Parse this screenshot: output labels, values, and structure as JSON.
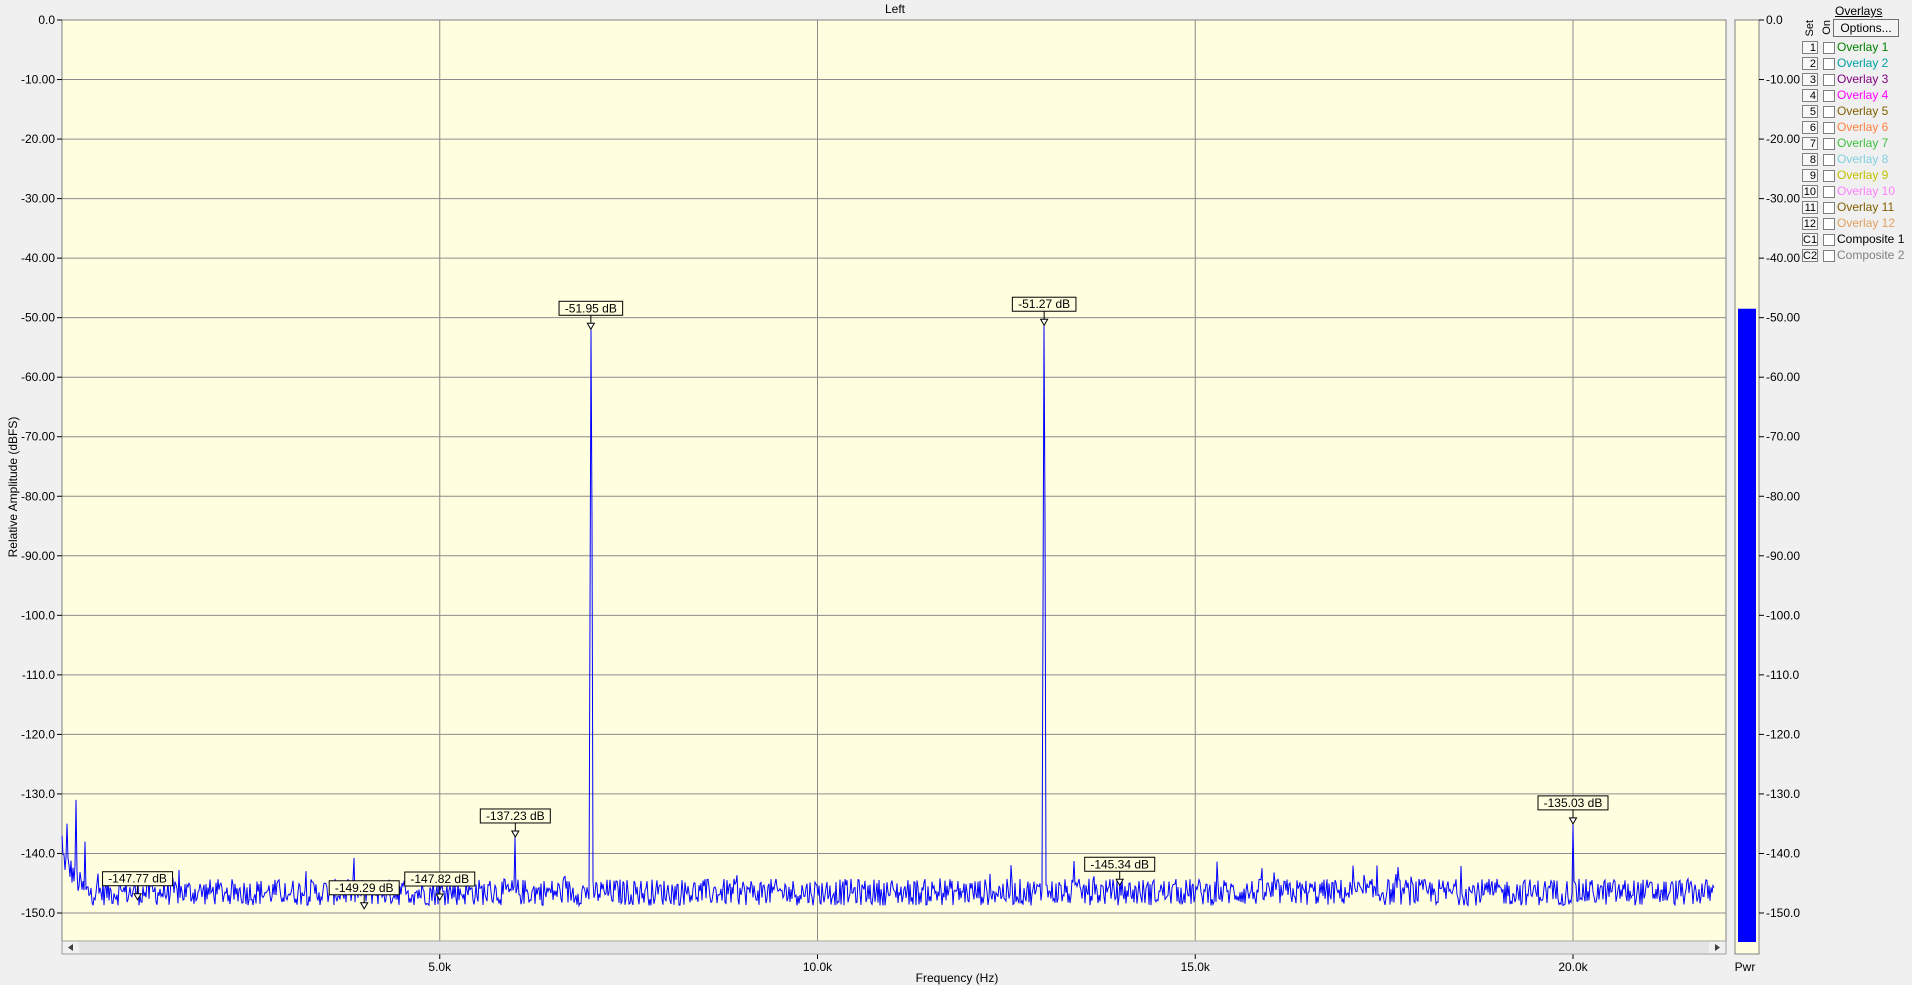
{
  "chart_data": {
    "type": "line",
    "title": "Left",
    "xlabel": "Frequency (Hz)",
    "ylabel": "Relative Amplitude (dBFS)",
    "xlim": [
      0,
      22050
    ],
    "ylim": [
      -157,
      0
    ],
    "x_tick_labels": [
      "5.0k",
      "10.0k",
      "15.0k",
      "20.0k"
    ],
    "x_ticks": [
      5000,
      10000,
      15000,
      20000
    ],
    "y_ticks": [
      0,
      -10,
      -20,
      -30,
      -40,
      -50,
      -60,
      -70,
      -80,
      -90,
      -100,
      -110,
      -120,
      -130,
      -140,
      -150
    ],
    "y_tick_labels": [
      "0.0",
      "-10.00",
      "-20.00",
      "-30.00",
      "-40.00",
      "-50.00",
      "-60.00",
      "-70.00",
      "-80.00",
      "-90.00",
      "-100.0",
      "-110.0",
      "-120.0",
      "-130.0",
      "-140.0",
      "-150.0"
    ],
    "grid": true,
    "noise_floor_db": -146.5,
    "series": [
      {
        "color": "#0000ff",
        "peaks": [
          {
            "x": 0,
            "y": -137
          },
          {
            "x": 60,
            "y": -135
          },
          {
            "x": 180,
            "y": -131
          },
          {
            "x": 300,
            "y": -138
          },
          {
            "x": 6000,
            "y": -137.23
          },
          {
            "x": 7000,
            "y": -51.95
          },
          {
            "x": 13000,
            "y": -51.27
          },
          {
            "x": 17400,
            "y": -142
          },
          {
            "x": 20000,
            "y": -135.03
          }
        ]
      }
    ],
    "markers": [
      {
        "x": 7000,
        "y": -51.95,
        "label": "-51.95 dB"
      },
      {
        "x": 13000,
        "y": -51.27,
        "label": "-51.27 dB"
      },
      {
        "x": 6000,
        "y": -137.23,
        "label": "-137.23 dB"
      },
      {
        "x": 20000,
        "y": -135.03,
        "label": "-135.03 dB"
      },
      {
        "x": 1000,
        "y": -147.77,
        "label": "-147.77 dB"
      },
      {
        "x": 4000,
        "y": -149.29,
        "label": "-149.29 dB"
      },
      {
        "x": 5000,
        "y": -147.82,
        "label": "-147.82 dB"
      },
      {
        "x": 14000,
        "y": -145.34,
        "label": "-145.34 dB"
      }
    ],
    "level_meter": {
      "value_db": -48.5,
      "label": "Pwr",
      "tick_labels": [
        "0.0",
        "-10.00",
        "-20.00",
        "-30.00",
        "-40.00",
        "-50.00",
        "-60.00",
        "-70.00",
        "-80.00",
        "-90.00",
        "-100.0",
        "-110.0",
        "-120.0",
        "-130.0",
        "-140.0",
        "-150.0"
      ],
      "color": "#0000ff"
    }
  },
  "overlays": {
    "title": "Overlays",
    "options_label": "Options...",
    "set_header": "Set",
    "on_header": "On",
    "items": [
      {
        "num": "1",
        "label": "Overlay 1",
        "color": "#008000"
      },
      {
        "num": "2",
        "label": "Overlay 2",
        "color": "#00a0a0"
      },
      {
        "num": "3",
        "label": "Overlay 3",
        "color": "#800080"
      },
      {
        "num": "4",
        "label": "Overlay 4",
        "color": "#ff00ff"
      },
      {
        "num": "5",
        "label": "Overlay 5",
        "color": "#806000"
      },
      {
        "num": "6",
        "label": "Overlay 6",
        "color": "#ff8040"
      },
      {
        "num": "7",
        "label": "Overlay 7",
        "color": "#40c040"
      },
      {
        "num": "8",
        "label": "Overlay 8",
        "color": "#80d0e0"
      },
      {
        "num": "9",
        "label": "Overlay 9",
        "color": "#c0c000"
      },
      {
        "num": "10",
        "label": "Overlay 10",
        "color": "#ff80ff"
      },
      {
        "num": "11",
        "label": "Overlay 11",
        "color": "#806000"
      },
      {
        "num": "12",
        "label": "Overlay 12",
        "color": "#e0a060"
      },
      {
        "num": "C1",
        "label": "Composite 1",
        "color": "#000000"
      },
      {
        "num": "C2",
        "label": "Composite 2",
        "color": "#808080"
      }
    ]
  },
  "colors": {
    "plot_background": "#ffffe0",
    "trace": "#0000ff",
    "grid": "#808080"
  }
}
